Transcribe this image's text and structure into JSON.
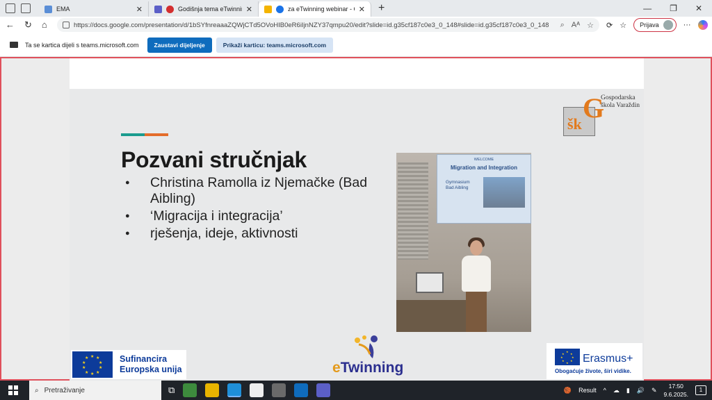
{
  "tabs": [
    {
      "title": "EMA",
      "favicon_color": "#5a8ed6"
    },
    {
      "title": "Godišnja tema eTwinninga k",
      "favicon_color": "#d32f2f"
    },
    {
      "title": "za eTwinning webinar - Goo",
      "favicon_color": "#f4b400"
    }
  ],
  "address": {
    "url": "https://docs.google.com/presentation/d/1bSYfnreaaaZQWjCTd5OVoHIB0eR6iIjnNZY37qmpu20/edit?slide=id.g35cf187c0e3_0_148#slide=id.g35cf187c0e3_0_148",
    "signin_label": "Prijava"
  },
  "share": {
    "message": "Ta se kartica dijeli s teams.microsoft.com",
    "stop_label": "Zaustavi dijeljenje",
    "show_label": "Prikaži karticu: teams.microsoft.com"
  },
  "slide": {
    "title": "Pozvani stručnjak",
    "bullets": [
      "Christina Ramolla iz Njemačke (Bad Aibling)",
      "‘Migracija i integracija’",
      "rješenja, ideje, aktivnosti"
    ],
    "school_logo": {
      "letters": "šk",
      "big": "G",
      "name_line1": "Gospodarska",
      "name_line2": "škola Varaždin"
    },
    "photo": {
      "proj_welcome": "WELCOME",
      "proj_title": "Migration and Integration",
      "proj_school1": "Gymnasium",
      "proj_school2": "Bad Aibling"
    },
    "eu_left": {
      "line1": "Sufinancira",
      "line2": "Europska unija"
    },
    "etwinning": {
      "e": "e",
      "rest": "Twinning"
    },
    "erasmus": {
      "name": "Erasmus+",
      "tagline": "Obogaćuje živote, širi vidike."
    }
  },
  "taskbar": {
    "search_placeholder": "Pretraživanje",
    "weather": "Result",
    "time": "17:50",
    "date": "9.6.2025.",
    "notifications": "1"
  },
  "colors": {
    "accent_teal": "#1a9b8e",
    "accent_orange": "#e46c2a",
    "share_border": "#e0505b",
    "stop_button": "#0f6cbd"
  }
}
